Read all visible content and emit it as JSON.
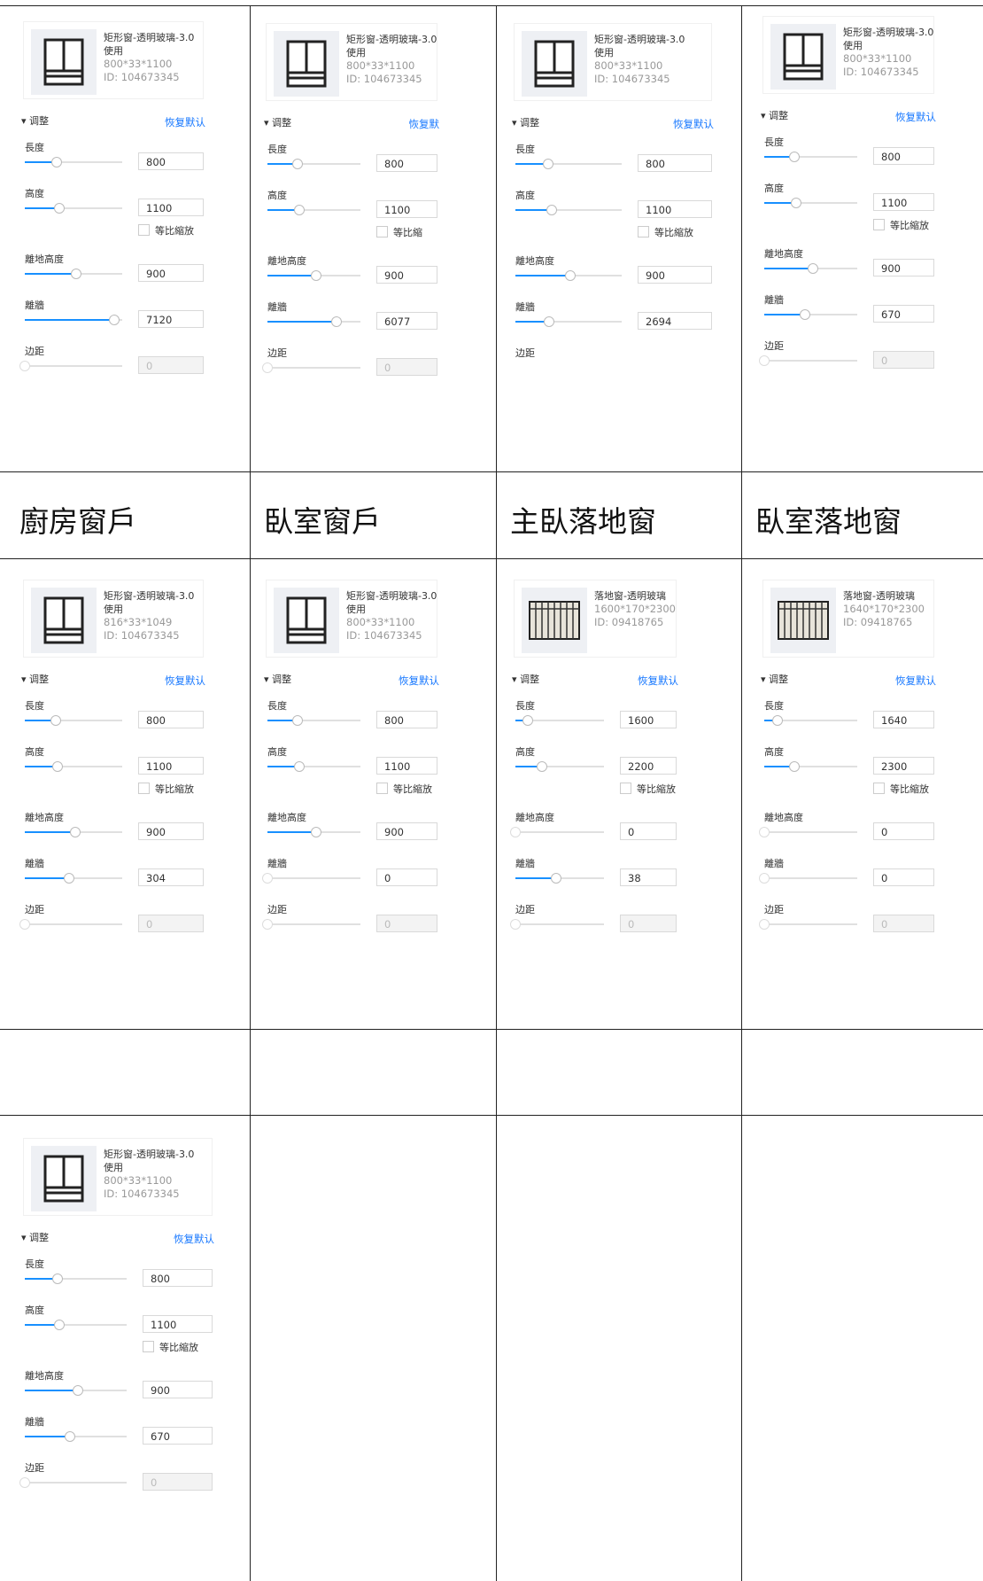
{
  "row_titles": [
    "廚房窗戶",
    "臥室窗戶",
    "主臥落地窗",
    "臥室落地窗"
  ],
  "panels": [
    {
      "name": "矩形窗-透明玻璃-3.0使用",
      "dims": "800*33*1100",
      "id": "ID: 104673345",
      "icon": "window-icon",
      "section": "▾ 调整",
      "reset": "恢复默认",
      "fields": [
        {
          "label": "長度",
          "value": "800",
          "level": 0.33
        },
        {
          "label": "高度",
          "value": "1100",
          "level": 0.35
        },
        {
          "label": "離地高度",
          "value": "900",
          "level": 0.53
        },
        {
          "label": "離牆",
          "value": "7120",
          "level": 0.92
        },
        {
          "label": "边距",
          "value": "0",
          "level": 0
        }
      ],
      "ratio": "等比縮放"
    },
    {
      "name": "矩形窗-透明玻璃-3.0使用",
      "dims": "800*33*1100",
      "id": "ID: 104673345",
      "icon": "window-icon",
      "section": "▾ 调整",
      "reset": "恢复默",
      "fields": [
        {
          "label": "長度",
          "value": "800",
          "level": 0.32
        },
        {
          "label": "高度",
          "value": "1100",
          "level": 0.34
        },
        {
          "label": "離地高度",
          "value": "900",
          "level": 0.52
        },
        {
          "label": "離牆",
          "value": "6077",
          "level": 0.74
        },
        {
          "label": "边距",
          "value": "0",
          "level": 0
        }
      ],
      "ratio": "等比縮"
    },
    {
      "name": "矩形窗-透明玻璃-3.0使用",
      "dims": "800*33*1100",
      "id": "ID: 104673345",
      "icon": "window-icon",
      "section": "▾ 调整",
      "reset": "恢复默认",
      "fields": [
        {
          "label": "長度",
          "value": "800",
          "level": 0.31
        },
        {
          "label": "高度",
          "value": "1100",
          "level": 0.34
        },
        {
          "label": "離地高度",
          "value": "900",
          "level": 0.52
        },
        {
          "label": "離牆",
          "value": "2694",
          "level": 0.32
        },
        {
          "label": "边距",
          "value": "",
          "level": null
        }
      ],
      "ratio": "等比縮放"
    },
    {
      "name": "矩形窗-透明玻璃-3.0使用",
      "dims": "800*33*1100",
      "id": "ID: 104673345",
      "icon": "window-icon",
      "section": "▾ 调整",
      "reset": "恢复默认",
      "fields": [
        {
          "label": "長度",
          "value": "800",
          "level": 0.32
        },
        {
          "label": "高度",
          "value": "1100",
          "level": 0.34
        },
        {
          "label": "離地高度",
          "value": "900",
          "level": 0.52
        },
        {
          "label": "離牆",
          "value": "670",
          "level": 0.44
        },
        {
          "label": "边距",
          "value": "0",
          "level": 0
        }
      ],
      "ratio": "等比縮放"
    },
    {
      "name": "矩形窗-透明玻璃-3.0使用",
      "dims": "816*33*1049",
      "id": "ID: 104673345",
      "icon": "window-icon",
      "section": "▾ 调整",
      "reset": "恢复默认",
      "fields": [
        {
          "label": "長度",
          "value": "800",
          "level": 0.32
        },
        {
          "label": "高度",
          "value": "1100",
          "level": 0.34
        },
        {
          "label": "離地高度",
          "value": "900",
          "level": 0.52
        },
        {
          "label": "離牆",
          "value": "304",
          "level": 0.45
        },
        {
          "label": "边距",
          "value": "0",
          "level": 0
        }
      ],
      "ratio": "等比縮放"
    },
    {
      "name": "矩形窗-透明玻璃-3.0使用",
      "dims": "800*33*1100",
      "id": "ID: 104673345",
      "icon": "window-icon",
      "section": "▾ 调整",
      "reset": "恢复默认",
      "fields": [
        {
          "label": "長度",
          "value": "800",
          "level": 0.32
        },
        {
          "label": "高度",
          "value": "1100",
          "level": 0.34
        },
        {
          "label": "離地高度",
          "value": "900",
          "level": 0.52
        },
        {
          "label": "離牆",
          "value": "0",
          "level": 0
        },
        {
          "label": "边距",
          "value": "0",
          "level": 0
        }
      ],
      "ratio": "等比縮放"
    },
    {
      "name": "落地窗-透明玻璃",
      "dims": "1600*170*2300",
      "id": "ID: 09418765",
      "icon": "french-window-icon",
      "section": "▾ 调整",
      "reset": "恢复默认",
      "fields": [
        {
          "label": "長度",
          "value": "1600",
          "level": 0.14
        },
        {
          "label": "高度",
          "value": "2200",
          "level": 0.3
        },
        {
          "label": "離地高度",
          "value": "0",
          "level": 0
        },
        {
          "label": "離牆",
          "value": "38",
          "level": 0.46
        },
        {
          "label": "边距",
          "value": "0",
          "level": 0
        }
      ],
      "ratio": "等比縮放"
    },
    {
      "name": "落地窗-透明玻璃",
      "dims": "1640*170*2300",
      "id": "ID: 09418765",
      "icon": "french-window-icon",
      "section": "▾ 调整",
      "reset": "恢复默认",
      "fields": [
        {
          "label": "長度",
          "value": "1640",
          "level": 0.14
        },
        {
          "label": "高度",
          "value": "2300",
          "level": 0.32
        },
        {
          "label": "離地高度",
          "value": "0",
          "level": 0
        },
        {
          "label": "離牆",
          "value": "0",
          "level": 0
        },
        {
          "label": "边距",
          "value": "0",
          "level": 0
        }
      ],
      "ratio": "等比縮放"
    },
    {
      "name": "矩形窗-透明玻璃-3.0使用",
      "dims": "800*33*1100",
      "id": "ID: 104673345",
      "icon": "window-icon",
      "section": "▾ 调整",
      "reset": "恢复默认",
      "fields": [
        {
          "label": "長度",
          "value": "800",
          "level": 0.32
        },
        {
          "label": "高度",
          "value": "1100",
          "level": 0.34
        },
        {
          "label": "離地高度",
          "value": "900",
          "level": 0.52
        },
        {
          "label": "離牆",
          "value": "670",
          "level": 0.44
        },
        {
          "label": "边距",
          "value": "0",
          "level": 0
        }
      ],
      "ratio": "等比縮放"
    }
  ]
}
